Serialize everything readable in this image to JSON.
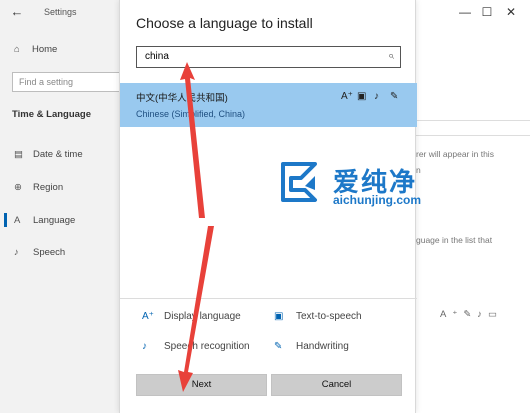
{
  "settings_window": {
    "title": "Settings",
    "back_icon": "back-arrow-icon",
    "minimize": "—",
    "maximize": "☐",
    "close": "✕",
    "nav": {
      "home": "Home",
      "find_placeholder": "Find a setting",
      "section": "Time & Language",
      "items": [
        {
          "label": "Date & time",
          "icon": "clock-calendar-icon"
        },
        {
          "label": "Region",
          "icon": "globe-icon"
        },
        {
          "label": "Language",
          "icon": "language-icon"
        },
        {
          "label": "Speech",
          "icon": "microphone-icon"
        }
      ]
    },
    "right_fragments": {
      "line1": "rer will appear in this",
      "line2": "n",
      "line3": "guage in the list that"
    }
  },
  "dialog": {
    "title": "Choose a language to install",
    "search": {
      "value": "china",
      "icon": "search-icon"
    },
    "results": [
      {
        "name": "中文(中华人民共和国)",
        "sub": "Chinese (Simplified, China)",
        "features": [
          "display-language-icon",
          "text-to-speech-icon",
          "speech-recognition-icon",
          "handwriting-icon"
        ]
      }
    ],
    "legend": {
      "display_language": "Display language",
      "text_to_speech": "Text-to-speech",
      "speech_recognition": "Speech recognition",
      "handwriting": "Handwriting"
    },
    "buttons": {
      "next": "Next",
      "cancel": "Cancel"
    }
  },
  "watermark": {
    "cn": "爱纯净",
    "en": "aichunjing.com"
  },
  "colors": {
    "accent": "#0063b1",
    "selection": "#99c9ef",
    "arrow": "#e8413a",
    "watermark": "#1d78c8"
  }
}
